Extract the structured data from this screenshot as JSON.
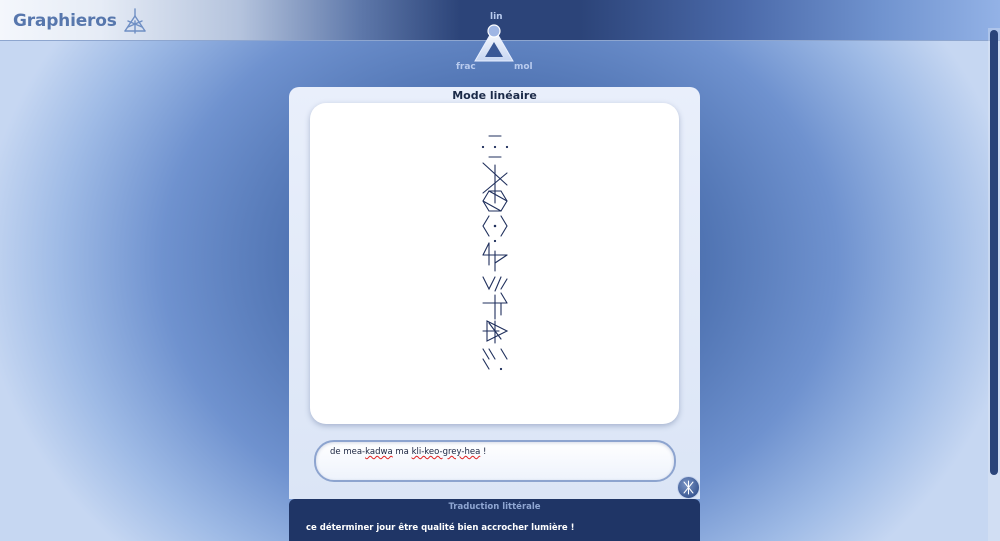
{
  "header": {
    "logo_text": "Graphieros",
    "logo_icon": "graphieros-glyph-icon"
  },
  "mode_switch": {
    "lin": "lin",
    "frac": "frac",
    "mol": "mol",
    "selected": "lin"
  },
  "panel": {
    "title": "Mode linéaire"
  },
  "input": {
    "text_parts": [
      "de mea-",
      "kadwa",
      " ma ",
      "kli-keo-grey-hea",
      " !"
    ]
  },
  "translation": {
    "title": "Traduction littérale",
    "text": "ce déterminer jour être qualité bien accrocher lumière !"
  },
  "colors": {
    "glyph_stroke": "#1f2f5c",
    "panel_bg": "#e3eaf8",
    "translation_bg": "#1f3566"
  }
}
